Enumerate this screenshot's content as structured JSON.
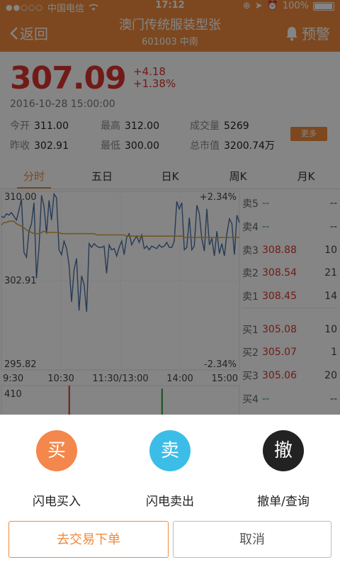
{
  "status_bar": {
    "signal_dots": "●●○○○",
    "carrier": "中国电信",
    "time": "17:12",
    "battery": "100%"
  },
  "nav": {
    "back_label": "返回",
    "title": "澳门传统服装型张",
    "subtitle": "601003  中南",
    "alert_label": "预警"
  },
  "quote": {
    "price": "307.09",
    "change": "+4.18",
    "change_pct": "+1.38%",
    "timestamp": "2016-10-28 15:00:00",
    "more_label": "更多",
    "stats": [
      {
        "label": "今开",
        "value": "311.00"
      },
      {
        "label": "最高",
        "value": "312.00"
      },
      {
        "label": "成交量",
        "value": "5269"
      },
      {
        "label": "昨收",
        "value": "302.91"
      },
      {
        "label": "最低",
        "value": "300.00"
      },
      {
        "label": "总市值",
        "value": "3200.74万"
      }
    ]
  },
  "tabs": [
    "分时",
    "五日",
    "日K",
    "周K",
    "月K"
  ],
  "chart_data": {
    "type": "line",
    "y_axis_labels": {
      "top": "310.00",
      "mid": "302.91",
      "bottom": "295.82"
    },
    "pct_labels": {
      "top": "+2.34%",
      "bottom": "-2.34%"
    },
    "x_labels": [
      "9:30",
      "10:30",
      "11:30/13:00",
      "14:00",
      "15:00"
    ],
    "volume_label": "410",
    "ylim": [
      295.82,
      310.0
    ],
    "series": [
      {
        "color": "#4a6fa5",
        "values": [
          308.1,
          308.0,
          308.3,
          308.2,
          308.4,
          308.1,
          307.8,
          308.6,
          309.5,
          305.2,
          304.8,
          306.9,
          307.5,
          309.2,
          303.1,
          305.6,
          309.8,
          308.9,
          306.7,
          309.4,
          307.8,
          309.9,
          309.6,
          305.4,
          305.0,
          306.1,
          305.5,
          304.2,
          301.2,
          303.8,
          304.7,
          300.5,
          303.3,
          302.6,
          300.4,
          305.9,
          305.6,
          305.9,
          305.7,
          305.6,
          305.6,
          305.7,
          303.5,
          305.8,
          305.4,
          305.5,
          304.9,
          305.6,
          306.1,
          305.0,
          306.4,
          306.7,
          305.8,
          306.2,
          306.5,
          306.0,
          306.6,
          305.5,
          305.7,
          305.4,
          305.7,
          305.6,
          305.5,
          305.8,
          305.6,
          305.7,
          306.0,
          305.6,
          305.6,
          306.1,
          309.3,
          308.7,
          309.2,
          305.4,
          305.6,
          308.0,
          305.4,
          305.7,
          309.0,
          308.3,
          306.3,
          305.3,
          308.7,
          305.8,
          306.3,
          304.9,
          306.9,
          305.1,
          305.9,
          304.9,
          306.7,
          307.9,
          307.5,
          305.0,
          308.2,
          307.6
        ]
      },
      {
        "color": "#d9a33a",
        "values": [
          307.4,
          307.6,
          307.6,
          307.7,
          307.7,
          307.7,
          307.5,
          307.4,
          307.3,
          307.2,
          307.0,
          306.9,
          306.8,
          306.7,
          306.7,
          306.7,
          306.8,
          306.9,
          306.8,
          306.8,
          306.8,
          306.8,
          306.8,
          306.8,
          306.7,
          306.7,
          306.7,
          306.7,
          306.7,
          306.7,
          306.7,
          306.7,
          306.7,
          306.7,
          306.7,
          306.7,
          306.7,
          306.7,
          306.6,
          306.6,
          306.6,
          306.6,
          306.6,
          306.6,
          306.6,
          306.6,
          306.6,
          306.6,
          306.6,
          306.6,
          306.5,
          306.5,
          306.5,
          306.5,
          306.5,
          306.5,
          306.5,
          306.5,
          306.5,
          306.5,
          306.5,
          306.5,
          306.5,
          306.5,
          306.5,
          306.5,
          306.5,
          306.5,
          306.5,
          306.5,
          306.5,
          306.5,
          306.5,
          306.4,
          306.4,
          306.4,
          306.4,
          306.4,
          306.4,
          306.4,
          306.4,
          306.4,
          306.4,
          306.4,
          306.4,
          306.4,
          306.4,
          306.4,
          306.4,
          306.4,
          306.4,
          306.4,
          306.4,
          306.4,
          306.4,
          306.4
        ]
      }
    ],
    "volume_bars": [
      {
        "x_frac": 0.285,
        "value": 410,
        "color": "#d8342e"
      },
      {
        "x_frac": 0.675,
        "value": 370,
        "color": "#2a9d3c"
      }
    ]
  },
  "order_book": [
    {
      "label": "卖5",
      "price": "--",
      "qty": "--",
      "color": "green"
    },
    {
      "label": "卖4",
      "price": "--",
      "qty": "--",
      "color": "green"
    },
    {
      "label": "卖3",
      "price": "308.88",
      "qty": "10",
      "color": "red"
    },
    {
      "label": "卖2",
      "price": "308.54",
      "qty": "21",
      "color": "red"
    },
    {
      "label": "卖1",
      "price": "308.45",
      "qty": "14",
      "color": "red"
    },
    {
      "label": "买1",
      "price": "305.08",
      "qty": "10",
      "color": "red"
    },
    {
      "label": "买2",
      "price": "305.07",
      "qty": "1",
      "color": "red"
    },
    {
      "label": "买3",
      "price": "305.06",
      "qty": "20",
      "color": "red"
    },
    {
      "label": "买4",
      "price": "--",
      "qty": "--",
      "color": "green"
    }
  ],
  "sheet": {
    "actions": [
      {
        "icon_char": "买",
        "label": "闪电买入",
        "color": "#f4874b"
      },
      {
        "icon_char": "卖",
        "label": "闪电卖出",
        "color": "#3cbde8"
      },
      {
        "icon_char": "撤",
        "label": "撤单/查询",
        "color": "#222222"
      }
    ],
    "primary_button": "去交易下单",
    "cancel_button": "取消"
  },
  "colors": {
    "accent": "#f08a3c",
    "up": "#d8342e",
    "down": "#2a9d3c"
  }
}
